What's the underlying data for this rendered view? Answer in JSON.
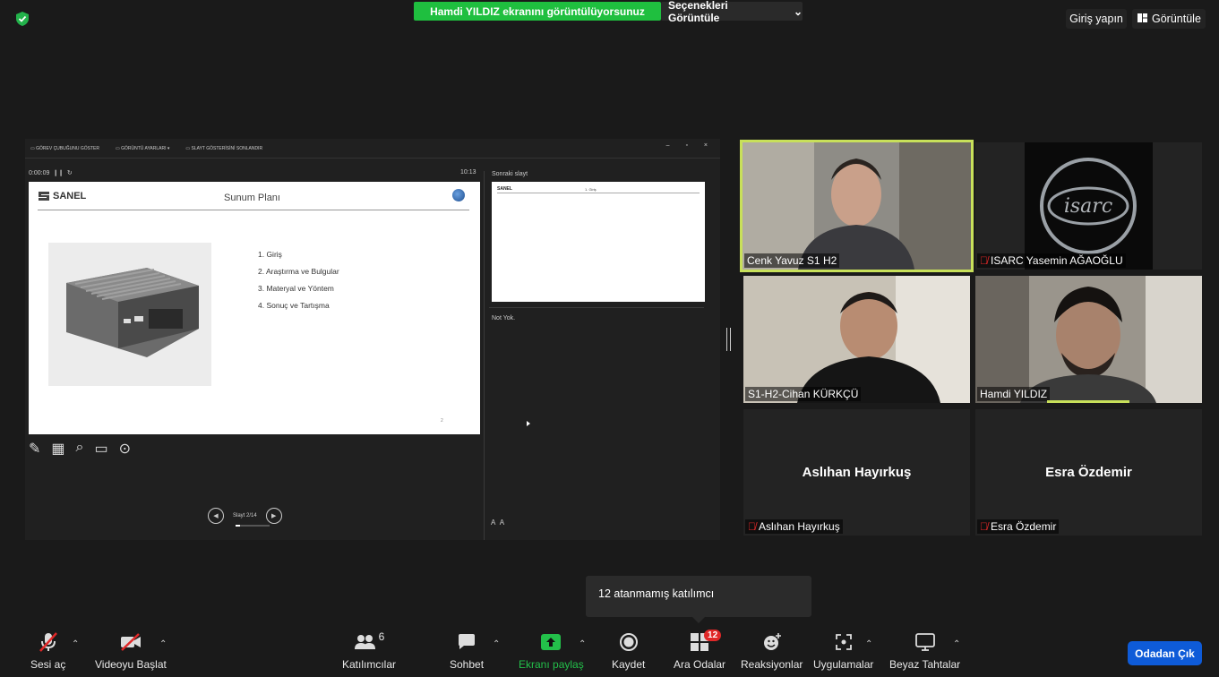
{
  "top": {
    "share_notice": "Hamdi YILDIZ ekranını görüntülüyorsunuz",
    "view_options": "Seçenekleri Görüntüle",
    "sign_in": "Giriş yapın",
    "view": "Görüntüle"
  },
  "presenter": {
    "toolbar": [
      "GÖREV ÇUBUĞUNU GÖSTER",
      "GÖRÜNTÜ AYARLARI ▾",
      "SLAYT GÖSTERİSİNİ SONLANDIR"
    ],
    "timer": "0:00:09",
    "clock": "10:13",
    "next_slide_label": "Sonraki slayt",
    "notes": "Not Yok.",
    "slide_counter": "Slayt 2/14",
    "slide_progress_fraction": 0.143,
    "slide": {
      "logo": "SANEL",
      "title": "Sunum Planı",
      "items": [
        "1.  Giriş",
        "2.  Araştırma ve Bulgular",
        "3.  Materyal ve Yöntem",
        "4.  Sonuç ve Tartışma"
      ],
      "page_number": "2"
    },
    "next_slide": {
      "logo": "SANEL",
      "title": "1. Giriş"
    }
  },
  "participants": [
    {
      "name": "Cenk Yavuz S1 H2",
      "muted": false,
      "active_speaker": true
    },
    {
      "name": "ISARC Yasemin AĞAOĞLU",
      "muted": true
    },
    {
      "name": "S1-H2-Cihan KÜRKÇÜ",
      "muted": false
    },
    {
      "name": "Hamdi YILDIZ",
      "muted": false
    },
    {
      "name": "Aslıhan Hayırkuş",
      "display": "Aslıhan Hayırkuş",
      "muted": true
    },
    {
      "name": "Esra Özdemir",
      "display": "Esra Özdemir",
      "muted": true
    }
  ],
  "tooltip": "12 atanmamış katılımcı",
  "toolbar": {
    "audio": "Sesi aç",
    "video": "Videoyu Başlat",
    "participants": "Katılımcılar",
    "participants_count": "6",
    "chat": "Sohbet",
    "share": "Ekranı paylaş",
    "record": "Kaydet",
    "breakout": "Ara Odalar",
    "breakout_badge": "12",
    "reactions": "Reaksiyonlar",
    "apps": "Uygulamalar",
    "whiteboard": "Beyaz Tahtalar",
    "leave": "Odadan Çık"
  },
  "colors": {
    "share_banner": "#1fbf3f",
    "leave_button": "#0e5bd8",
    "active_speaker_border": "#c8e05a",
    "mute_red": "#e02828"
  }
}
